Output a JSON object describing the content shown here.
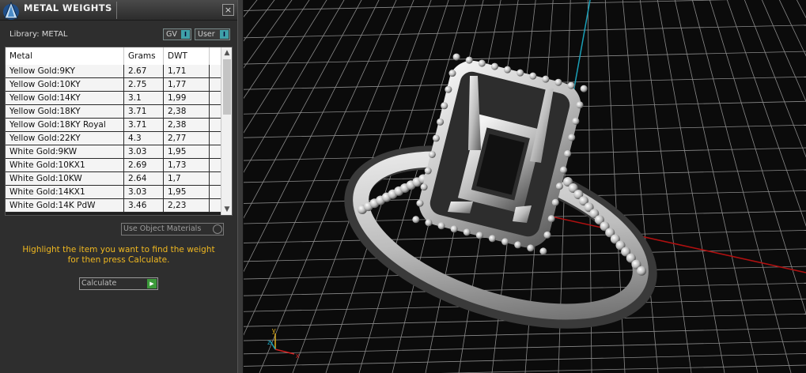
{
  "panel": {
    "title": "METAL WEIGHTS",
    "close_glyph": "×",
    "library_label": "Library: METAL",
    "toggles": [
      {
        "label": "GV",
        "state_glyph": "I"
      },
      {
        "label": "User",
        "state_glyph": "I"
      }
    ],
    "table": {
      "columns": [
        "Metal",
        "Grams",
        "DWT"
      ],
      "rows": [
        {
          "metal": "Yellow Gold:9KY",
          "grams": "2.67",
          "dwt": "1,71"
        },
        {
          "metal": "Yellow Gold:10KY",
          "grams": "2.75",
          "dwt": "1,77"
        },
        {
          "metal": "Yellow Gold:14KY",
          "grams": "3.1",
          "dwt": "1,99"
        },
        {
          "metal": "Yellow Gold:18KY",
          "grams": "3.71",
          "dwt": "2,38"
        },
        {
          "metal": "Yellow Gold:18KY Royal",
          "grams": "3.71",
          "dwt": "2,38"
        },
        {
          "metal": "Yellow Gold:22KY",
          "grams": "4.3",
          "dwt": "2,77"
        },
        {
          "metal": "White Gold:9KW",
          "grams": "3.03",
          "dwt": "1,95"
        },
        {
          "metal": "White Gold:10KX1",
          "grams": "2.69",
          "dwt": "1,73"
        },
        {
          "metal": "White Gold:10KW",
          "grams": "2.64",
          "dwt": "1,7"
        },
        {
          "metal": "White Gold:14KX1",
          "grams": "3.03",
          "dwt": "1,95"
        },
        {
          "metal": "White Gold:14K PdW",
          "grams": "3.46",
          "dwt": "2,23"
        }
      ],
      "scroll_up_glyph": "▲",
      "scroll_down_glyph": "▼"
    },
    "use_object_materials_label": "Use Object Materials",
    "hint_line1": "Highlight the item you want to find the weight",
    "hint_line2": "for then press Calculate.",
    "calculate_label": "Calculate",
    "calculate_glyph": "▶"
  },
  "viewport": {
    "axis_labels": {
      "x": "x",
      "y": "y",
      "z": "z"
    },
    "colors": {
      "grid": "#8a8a8a",
      "x_axis": "#b01010",
      "z_axis": "#1aa0b8",
      "hint_text": "#f0b820"
    }
  }
}
